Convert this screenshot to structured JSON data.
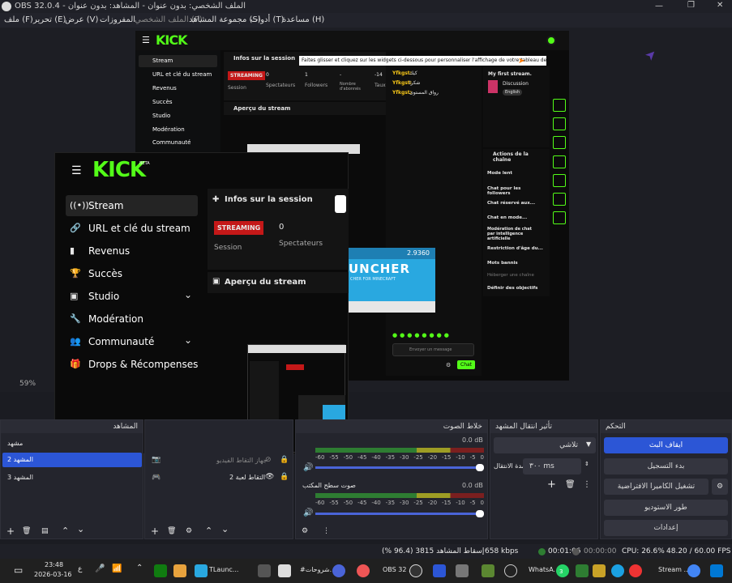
{
  "window": {
    "title": "OBS 32.0.4 - الملف الشخصي: بدون عنوان - المشاهد: بدون عنوان"
  },
  "menu": {
    "file": "ملف (F)",
    "edit": "تحرير (E)",
    "view": "عرض (V)",
    "docks": "المفروزات",
    "profile": "الملف الشخصي (P)",
    "scene_collection": "مجموعة المشاهد (S)",
    "tools": "أدوات (T)",
    "help": "مساعدة (H)"
  },
  "kick_back": {
    "brand": "KICK",
    "nav": [
      "Stream",
      "URL et clé du stream",
      "Revenus",
      "Succès",
      "Studio",
      "Modération",
      "Communauté"
    ],
    "session_title": "Infos sur la session",
    "badge": "STREAMING",
    "stats": [
      {
        "label": "Session",
        "value": ""
      },
      {
        "label": "Spectateurs",
        "value": "0"
      },
      {
        "label": "Followers",
        "value": "1"
      },
      {
        "label": "Nombre d'abonnés",
        "value": "-"
      },
      {
        "label": "Taux",
        "value": "-14"
      }
    ],
    "apercu": "Aperçu du stream",
    "tooltip": "Faites glisser et cliquez sur les widgets ci-dessous pour personnaliser l'affichage de votre tableau de bord",
    "chat": [
      {
        "user": "Yfkgst:",
        "msg": "كيك"
      },
      {
        "user": "Yfkgst:",
        "msg": "شكرا"
      },
      {
        "user": "Yfkgst:",
        "msg": "رواق المستوى"
      }
    ],
    "chat_placeholder": "Envoyer un message",
    "chat_button": "Chat",
    "first_stream": "My first stream.",
    "category": "Discussion",
    "language": "English",
    "actions_title": "Actions de la chaîne",
    "actions": [
      "Mode lent",
      "Chat pour les followers",
      "Chat réservé aux...",
      "Chat en mode...",
      "Modération de chat par intelligence artificielle",
      "Restriction d'âge du...",
      "Mots bannis",
      "Héberger une chaîne",
      "Définir des objectifs"
    ],
    "zoom": "59%"
  },
  "kick_front": {
    "brand": "KICK",
    "beta": "BETA",
    "nav": [
      "Stream",
      "URL et clé du stream",
      "Revenus",
      "Succès",
      "Studio",
      "Modération",
      "Communauté",
      "Drops & Récompenses"
    ],
    "session_title": "Infos sur la session",
    "badge": "STREAMING",
    "viewers": "0",
    "label_session": "Session",
    "label_viewers": "Spectateurs",
    "apercu": "Aperçu du stream"
  },
  "launcher": {
    "title": "UNCHER",
    "subtitle": "CHER FOR MINECRAFT",
    "version": "2.9360"
  },
  "scenes": {
    "title": "المشاهد",
    "items": [
      "مشهد",
      "المشهد 2",
      "المشهد 3"
    ],
    "selected": 1
  },
  "sources": {
    "title": "المصادر",
    "items": [
      {
        "name": "جهاز التقاط الفيديو"
      },
      {
        "name": "التقاط لعبة 2"
      }
    ]
  },
  "audio": {
    "title": "خلاط الصوت",
    "channels": [
      {
        "name": "صوت سطح المكتب",
        "db": "0.0 dB"
      },
      {
        "name": "المايك",
        "db": "0.0 dB"
      }
    ],
    "ticks": [
      "-60",
      "-55",
      "-50",
      "-45",
      "-40",
      "-35",
      "-30",
      "-25",
      "-20",
      "-15",
      "-10",
      "-5",
      "0"
    ]
  },
  "transitions": {
    "title": "تأثير انتقال المشهد",
    "type": "تلاشي",
    "duration_label": "مدة الانتقال",
    "duration": "٣٠٠ ms"
  },
  "controls": {
    "title": "التحكم",
    "stop_stream": "ايقاف البث",
    "start_record": "بدء التسجيل",
    "virtual_cam": "تشغيل الكاميرا الافتراضية",
    "studio_mode": "طور الاستوديو",
    "settings": "إعدادات"
  },
  "status": {
    "dropped": "إسقاط المشاهد 3815 (96.4 %)",
    "bitrate": "658 kbps",
    "stream_time": "00:01:06",
    "rec_time": "00:00:00",
    "cpu": "CPU: 26.6%",
    "fps": "48.20 / 60.00 FPS"
  },
  "taskbar": {
    "time": "23:48",
    "date": "2026-03-16",
    "lang": "ع",
    "apps": [
      "TLaunc...",
      "#شروحات...",
      "OBS 32 ...",
      "WhatsA...",
      "Stream ..."
    ],
    "badge": "3"
  },
  "colors": {
    "kick_green": "#53fc18",
    "obs_blue": "#2c56d6",
    "streaming_red": "#c41818"
  }
}
